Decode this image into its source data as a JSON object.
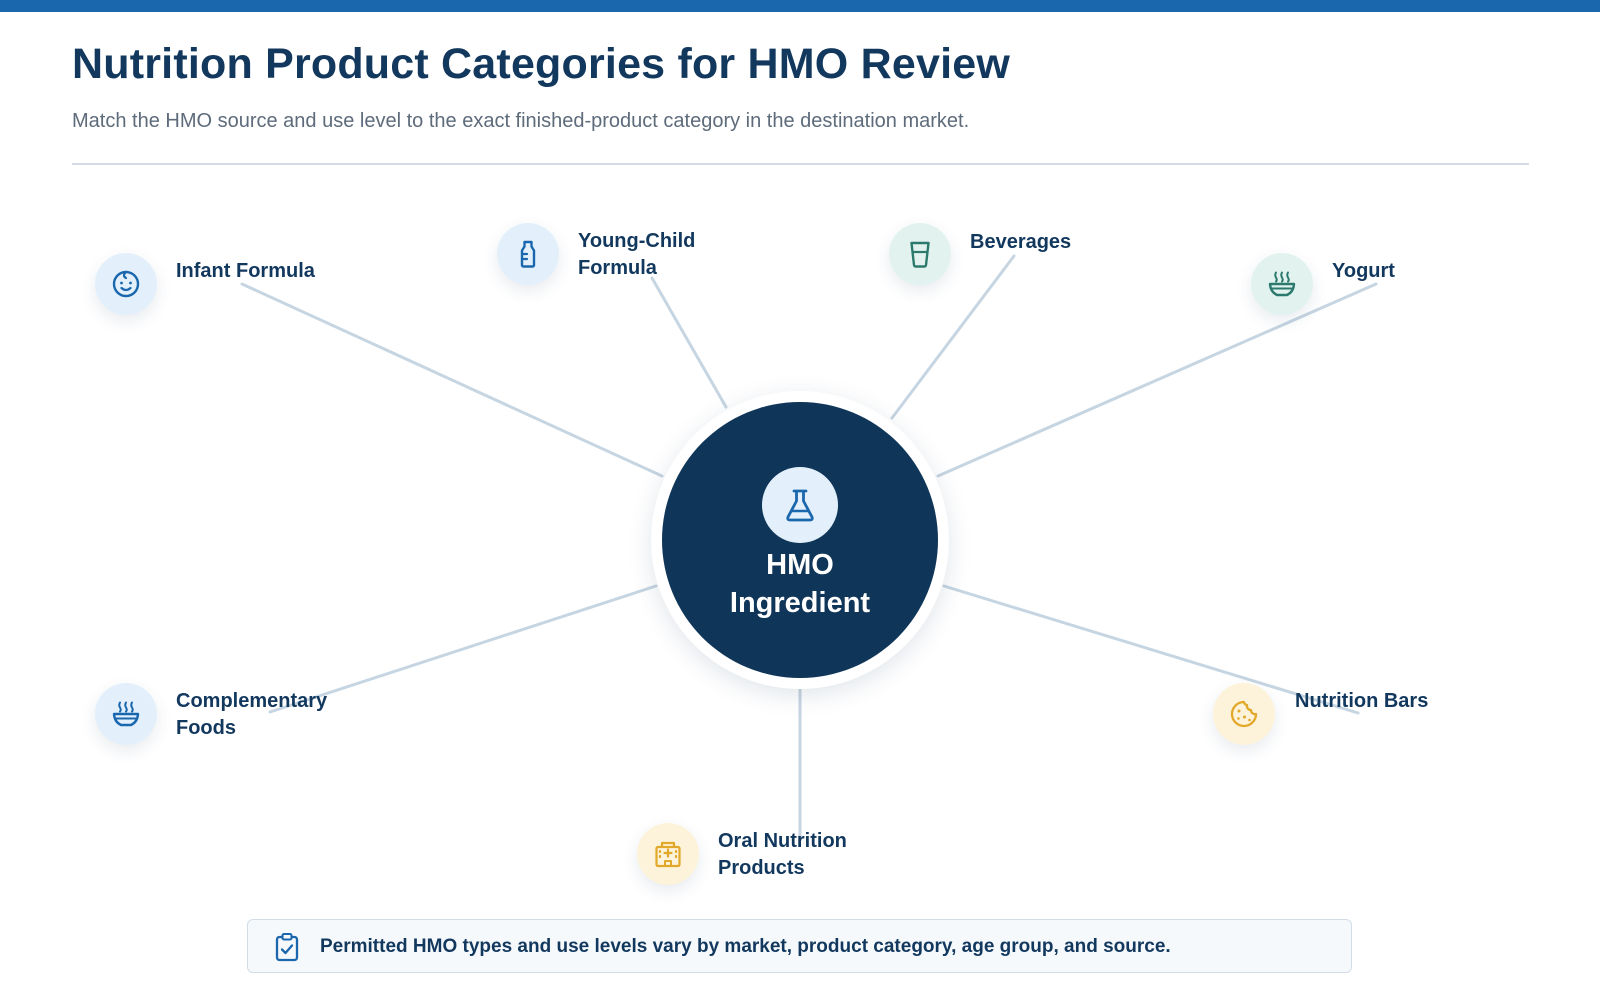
{
  "header": {
    "title": "Nutrition Product Categories for HMO Review",
    "subtitle": "Match the HMO source and use level to the exact finished-product category in the destination market."
  },
  "hub": {
    "label": "HMO Ingredient",
    "icon": "flask-icon"
  },
  "categories": [
    {
      "label": "Infant Formula",
      "icon": "baby-face-icon"
    },
    {
      "label": "Young-Child Formula",
      "icon": "bottle-icon"
    },
    {
      "label": "Beverages",
      "icon": "glass-icon"
    },
    {
      "label": "Yogurt",
      "icon": "bowl-steam-icon"
    },
    {
      "label": "Complementary Foods",
      "icon": "bowl-steam-icon"
    },
    {
      "label": "Oral Nutrition Products",
      "icon": "hospital-icon"
    },
    {
      "label": "Nutrition Bars",
      "icon": "cookie-icon"
    }
  ],
  "footer_note": {
    "text": "Permitted HMO types and use levels vary by market, product category, age group, and source.",
    "icon": "clipboard-check-icon"
  },
  "colors": {
    "accent": "#1b67ad",
    "navy": "#0f3558",
    "connector": "#c6d5e2",
    "blue_icon": "#1b67ad",
    "teal_icon": "#2c7a6d",
    "gold_icon": "#e2a82a"
  }
}
